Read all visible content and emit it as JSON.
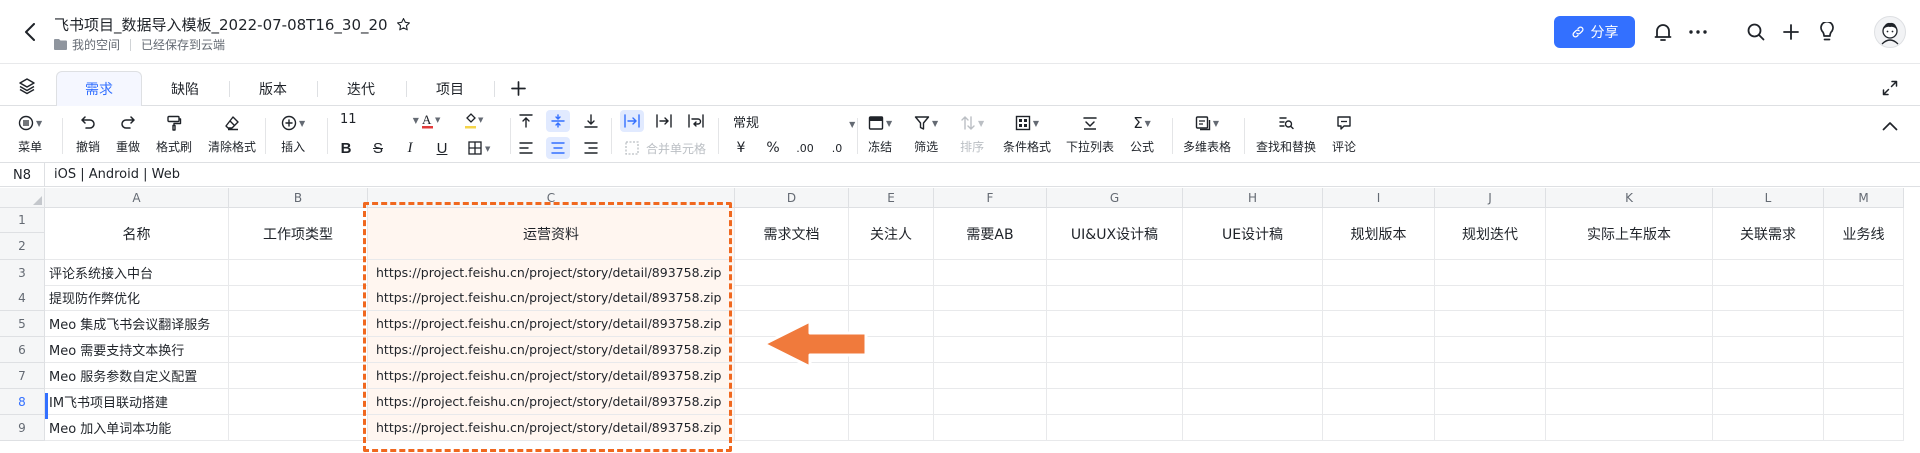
{
  "header": {
    "title": "飞书项目_数据导入模板_2022-07-08T16_30_20",
    "location": "我的空间",
    "save_status": "已经保存到云端",
    "share_label": "分享"
  },
  "tabs": [
    {
      "label": "需求",
      "active": true
    },
    {
      "label": "缺陷",
      "active": false
    },
    {
      "label": "版本",
      "active": false
    },
    {
      "label": "迭代",
      "active": false
    },
    {
      "label": "项目",
      "active": false
    }
  ],
  "toolbar": {
    "menu": "菜单",
    "undo": "撤销",
    "redo": "重做",
    "format_painter": "格式刷",
    "clear_format": "清除格式",
    "insert": "插入",
    "font_size": "11",
    "merge_cells": "合并单元格",
    "number_format": "常规",
    "freeze": "冻结",
    "filter": "筛选",
    "sort": "排序",
    "conditional_format": "条件格式",
    "dropdown_list": "下拉列表",
    "formula": "公式",
    "multi_table": "多维表格",
    "find_replace": "查找和替换",
    "comment": "评论"
  },
  "formula_bar": {
    "cell_ref": "N8",
    "content": "iOS | Android | Web"
  },
  "columns": [
    "A",
    "B",
    "C",
    "D",
    "E",
    "F",
    "G",
    "H",
    "I",
    "J",
    "K",
    "L",
    "M"
  ],
  "header_row": [
    "名称",
    "工作项类型",
    "运营资料",
    "需求文档",
    "关注人",
    "需要AB",
    "UI&UX设计稿",
    "UE设计稿",
    "规划版本",
    "规划迭代",
    "实际上车版本",
    "关联需求",
    "业务线"
  ],
  "row_numbers": [
    "1",
    "2",
    "3",
    "4",
    "5",
    "6",
    "7",
    "8",
    "9"
  ],
  "rows": [
    {
      "name": "评论系统接入中台",
      "link": "https://project.feishu.cn/project/story/detail/893758.zip"
    },
    {
      "name": "提现防作弊优化",
      "link": "https://project.feishu.cn/project/story/detail/893758.zip"
    },
    {
      "name": "Meo 集成飞书会议翻译服务",
      "link": "https://project.feishu.cn/project/story/detail/893758.zip"
    },
    {
      "name": "Meo 需要支持文本换行",
      "link": "https://project.feishu.cn/project/story/detail/893758.zip"
    },
    {
      "name": "Meo 服务参数自定义配置",
      "link": "https://project.feishu.cn/project/story/detail/893758.zip"
    },
    {
      "name": "IM飞书项目联动搭建",
      "link": "https://project.feishu.cn/project/story/detail/893758.zip"
    },
    {
      "name": "Meo 加入单词本功能",
      "link": "https://project.feishu.cn/project/story/detail/893758.zip"
    }
  ],
  "colors": {
    "accent": "#3370ff",
    "highlight": "#f0681f"
  }
}
